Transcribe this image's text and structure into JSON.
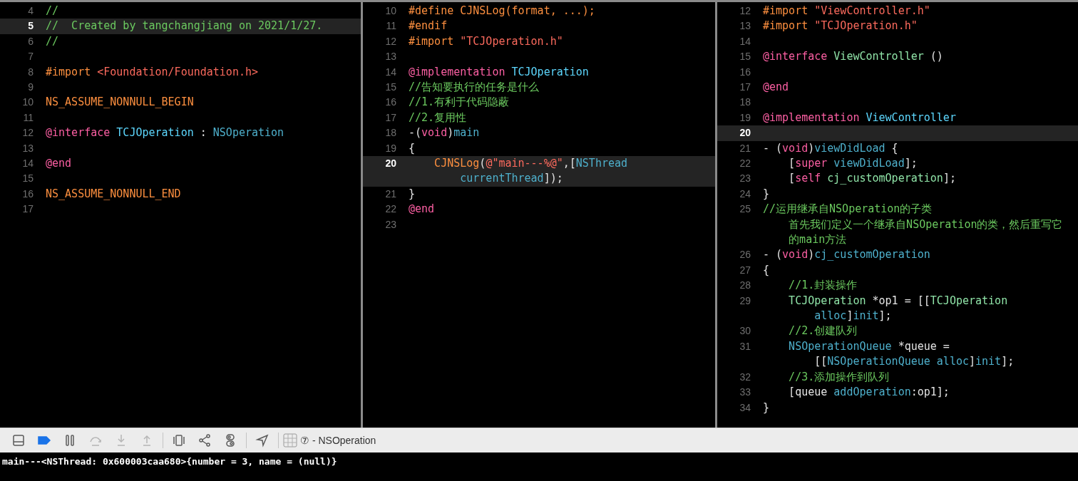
{
  "panes": [
    {
      "lines": [
        {
          "number": "4",
          "current": false,
          "tokens": [
            {
              "kind": "comment",
              "text": "//"
            }
          ]
        },
        {
          "number": "5",
          "current": true,
          "tokens": [
            {
              "kind": "comment",
              "text": "//  Created by tangchangjiang on 2021/1/27."
            }
          ]
        },
        {
          "number": "6",
          "current": false,
          "tokens": [
            {
              "kind": "comment",
              "text": "//"
            }
          ]
        },
        {
          "number": "7",
          "current": false
        },
        {
          "number": "8",
          "current": false,
          "tokens": [
            {
              "kind": "directive",
              "text": "#import "
            },
            {
              "kind": "string",
              "text": "<Foundation/Foundation.h>"
            }
          ]
        },
        {
          "number": "9",
          "current": false
        },
        {
          "number": "10",
          "current": false,
          "tokens": [
            {
              "kind": "macro",
              "text": "NS_ASSUME_NONNULL_BEGIN"
            }
          ]
        },
        {
          "number": "11",
          "current": false
        },
        {
          "number": "12",
          "current": false,
          "tokens": [
            {
              "kind": "keyword",
              "text": "@interface "
            },
            {
              "kind": "decl",
              "text": "TCJOperation"
            },
            {
              "kind": "plain",
              "text": " : "
            },
            {
              "kind": "system",
              "text": "NSOperation"
            }
          ]
        },
        {
          "number": "13",
          "current": false
        },
        {
          "number": "14",
          "current": false,
          "tokens": [
            {
              "kind": "keyword",
              "text": "@end"
            }
          ]
        },
        {
          "number": "15",
          "current": false
        },
        {
          "number": "16",
          "current": false,
          "tokens": [
            {
              "kind": "macro",
              "text": "NS_ASSUME_NONNULL_END"
            }
          ]
        },
        {
          "number": "17",
          "current": false
        }
      ]
    },
    {
      "lines": [
        {
          "number": "10",
          "current": false,
          "tokens": [
            {
              "kind": "directive",
              "text": "#define CJNSLog(format, ...);"
            }
          ]
        },
        {
          "number": "11",
          "current": false,
          "tokens": [
            {
              "kind": "directive",
              "text": "#endif"
            }
          ]
        },
        {
          "number": "12",
          "current": false,
          "tokens": [
            {
              "kind": "directive",
              "text": "#import "
            },
            {
              "kind": "string",
              "text": "\"TCJOperation.h\""
            }
          ]
        },
        {
          "number": "13",
          "current": false
        },
        {
          "number": "14",
          "current": false,
          "tokens": [
            {
              "kind": "keyword",
              "text": "@implementation "
            },
            {
              "kind": "decl",
              "text": "TCJOperation"
            }
          ]
        },
        {
          "number": "15",
          "current": false,
          "tokens": [
            {
              "kind": "comment",
              "text": "//告知要执行的任务是什么"
            }
          ]
        },
        {
          "number": "16",
          "current": false,
          "tokens": [
            {
              "kind": "comment",
              "text": "//1.有利于代码隐蔽"
            }
          ]
        },
        {
          "number": "17",
          "current": false,
          "tokens": [
            {
              "kind": "comment",
              "text": "//2.复用性"
            }
          ]
        },
        {
          "number": "18",
          "current": false,
          "tokens": [
            {
              "kind": "plain",
              "text": "-("
            },
            {
              "kind": "keyword",
              "text": "void"
            },
            {
              "kind": "plain",
              "text": ")"
            },
            {
              "kind": "method",
              "text": "main"
            }
          ]
        },
        {
          "number": "19",
          "current": false,
          "tokens": [
            {
              "kind": "plain",
              "text": "{"
            }
          ]
        },
        {
          "number": "20",
          "current": true,
          "tokens": [
            {
              "kind": "macro",
              "text": "    CJNSLog"
            },
            {
              "kind": "plain",
              "text": "("
            },
            {
              "kind": "string",
              "text": "@\"main---%@\""
            },
            {
              "kind": "plain",
              "text": ",["
            },
            {
              "kind": "system",
              "text": "NSThread"
            }
          ],
          "wrap": [
            {
              "tokens": [
                {
                  "kind": "system",
                  "text": "currentThread"
                },
                {
                  "kind": "plain",
                  "text": "]);"
                }
              ]
            }
          ]
        },
        {
          "number": "21",
          "current": false,
          "tokens": [
            {
              "kind": "plain",
              "text": "}"
            }
          ]
        },
        {
          "number": "22",
          "current": false,
          "tokens": [
            {
              "kind": "keyword",
              "text": "@end"
            }
          ]
        },
        {
          "number": "23",
          "current": false
        }
      ]
    },
    {
      "lines": [
        {
          "number": "12",
          "current": false,
          "tokens": [
            {
              "kind": "directive",
              "text": "#import "
            },
            {
              "kind": "string",
              "text": "\"ViewController.h\""
            }
          ]
        },
        {
          "number": "13",
          "current": false,
          "tokens": [
            {
              "kind": "directive",
              "text": "#import "
            },
            {
              "kind": "string",
              "text": "\"TCJOperation.h\""
            }
          ]
        },
        {
          "number": "14",
          "current": false
        },
        {
          "number": "15",
          "current": false,
          "tokens": [
            {
              "kind": "keyword",
              "text": "@interface "
            },
            {
              "kind": "project",
              "text": "ViewController"
            },
            {
              "kind": "plain",
              "text": " ()"
            }
          ]
        },
        {
          "number": "16",
          "current": false
        },
        {
          "number": "17",
          "current": false,
          "tokens": [
            {
              "kind": "keyword",
              "text": "@end"
            }
          ]
        },
        {
          "number": "18",
          "current": false
        },
        {
          "number": "19",
          "current": false,
          "tokens": [
            {
              "kind": "keyword",
              "text": "@implementation "
            },
            {
              "kind": "decl",
              "text": "ViewController"
            }
          ]
        },
        {
          "number": "20",
          "current": true
        },
        {
          "number": "21",
          "current": false,
          "tokens": [
            {
              "kind": "plain",
              "text": "- ("
            },
            {
              "kind": "keyword",
              "text": "void"
            },
            {
              "kind": "plain",
              "text": ")"
            },
            {
              "kind": "method",
              "text": "viewDidLoad"
            },
            {
              "kind": "plain",
              "text": " {"
            }
          ]
        },
        {
          "number": "22",
          "current": false,
          "tokens": [
            {
              "kind": "plain",
              "text": "    ["
            },
            {
              "kind": "keyword",
              "text": "super "
            },
            {
              "kind": "system",
              "text": "viewDidLoad"
            },
            {
              "kind": "plain",
              "text": "];"
            }
          ]
        },
        {
          "number": "23",
          "current": false,
          "tokens": [
            {
              "kind": "plain",
              "text": "    ["
            },
            {
              "kind": "keyword",
              "text": "self "
            },
            {
              "kind": "project",
              "text": "cj_customOperation"
            },
            {
              "kind": "plain",
              "text": "];"
            }
          ]
        },
        {
          "number": "24",
          "current": false,
          "tokens": [
            {
              "kind": "plain",
              "text": "}"
            }
          ]
        },
        {
          "number": "25",
          "current": false,
          "tokens": [
            {
              "kind": "comment",
              "text": "//运用继承自NSOperation的子类"
            }
          ],
          "wrap": [
            {
              "tokens": [
                {
                  "kind": "comment",
                  "text": "首先我们定义一个继承自NSOperation的类，然后重写它"
                }
              ]
            },
            {
              "tokens": [
                {
                  "kind": "comment",
                  "text": "的main方法"
                }
              ]
            }
          ]
        },
        {
          "number": "26",
          "current": false,
          "tokens": [
            {
              "kind": "plain",
              "text": "- ("
            },
            {
              "kind": "keyword",
              "text": "void"
            },
            {
              "kind": "plain",
              "text": ")"
            },
            {
              "kind": "method",
              "text": "cj_customOperation"
            }
          ]
        },
        {
          "number": "27",
          "current": false,
          "tokens": [
            {
              "kind": "plain",
              "text": "{"
            }
          ]
        },
        {
          "number": "28",
          "current": false,
          "tokens": [
            {
              "kind": "comment",
              "text": "    //1.封装操作"
            }
          ]
        },
        {
          "number": "29",
          "current": false,
          "tokens": [
            {
              "kind": "project",
              "text": "    TCJOperation"
            },
            {
              "kind": "plain",
              "text": " *op1 = [["
            },
            {
              "kind": "project",
              "text": "TCJOperation"
            }
          ],
          "wrap": [
            {
              "tokens": [
                {
                  "kind": "system",
                  "text": "alloc"
                },
                {
                  "kind": "plain",
                  "text": "]"
                },
                {
                  "kind": "system",
                  "text": "init"
                },
                {
                  "kind": "plain",
                  "text": "];"
                }
              ]
            }
          ]
        },
        {
          "number": "30",
          "current": false,
          "tokens": [
            {
              "kind": "comment",
              "text": "    //2.创建队列"
            }
          ]
        },
        {
          "number": "31",
          "current": false,
          "tokens": [
            {
              "kind": "system",
              "text": "    NSOperationQueue"
            },
            {
              "kind": "plain",
              "text": " *queue ="
            }
          ],
          "wrap": [
            {
              "tokens": [
                {
                  "kind": "plain",
                  "text": "[["
                },
                {
                  "kind": "system",
                  "text": "NSOperationQueue "
                },
                {
                  "kind": "system",
                  "text": "alloc"
                },
                {
                  "kind": "plain",
                  "text": "]"
                },
                {
                  "kind": "system",
                  "text": "init"
                },
                {
                  "kind": "plain",
                  "text": "];"
                }
              ]
            }
          ]
        },
        {
          "number": "32",
          "current": false,
          "tokens": [
            {
              "kind": "comment",
              "text": "    //3.添加操作到队列"
            }
          ]
        },
        {
          "number": "33",
          "current": false,
          "tokens": [
            {
              "kind": "plain",
              "text": "    [queue "
            },
            {
              "kind": "system",
              "text": "addOperation"
            },
            {
              "kind": "plain",
              "text": ":op1];"
            }
          ]
        },
        {
          "number": "34",
          "current": false,
          "tokens": [
            {
              "kind": "plain",
              "text": "}"
            }
          ]
        }
      ]
    }
  ],
  "debug_bar": {
    "buttons": [
      {
        "kind": "panel",
        "disabled": false
      },
      {
        "kind": "breakpoints",
        "disabled": false
      },
      {
        "kind": "pause",
        "disabled": false
      },
      {
        "kind": "step-over",
        "disabled": true
      },
      {
        "kind": "step-in",
        "disabled": true
      },
      {
        "kind": "step-out",
        "disabled": true
      },
      {
        "kind": "view-debugger",
        "disabled": false
      },
      {
        "kind": "memory-graph",
        "disabled": false
      },
      {
        "kind": "environment",
        "disabled": false
      },
      {
        "kind": "location",
        "disabled": false
      }
    ],
    "thread_label": "⑦ - NSOperation"
  },
  "console": {
    "output": "main---<NSThread: 0x600003caa680>{number = 3, name = (null)}"
  }
}
